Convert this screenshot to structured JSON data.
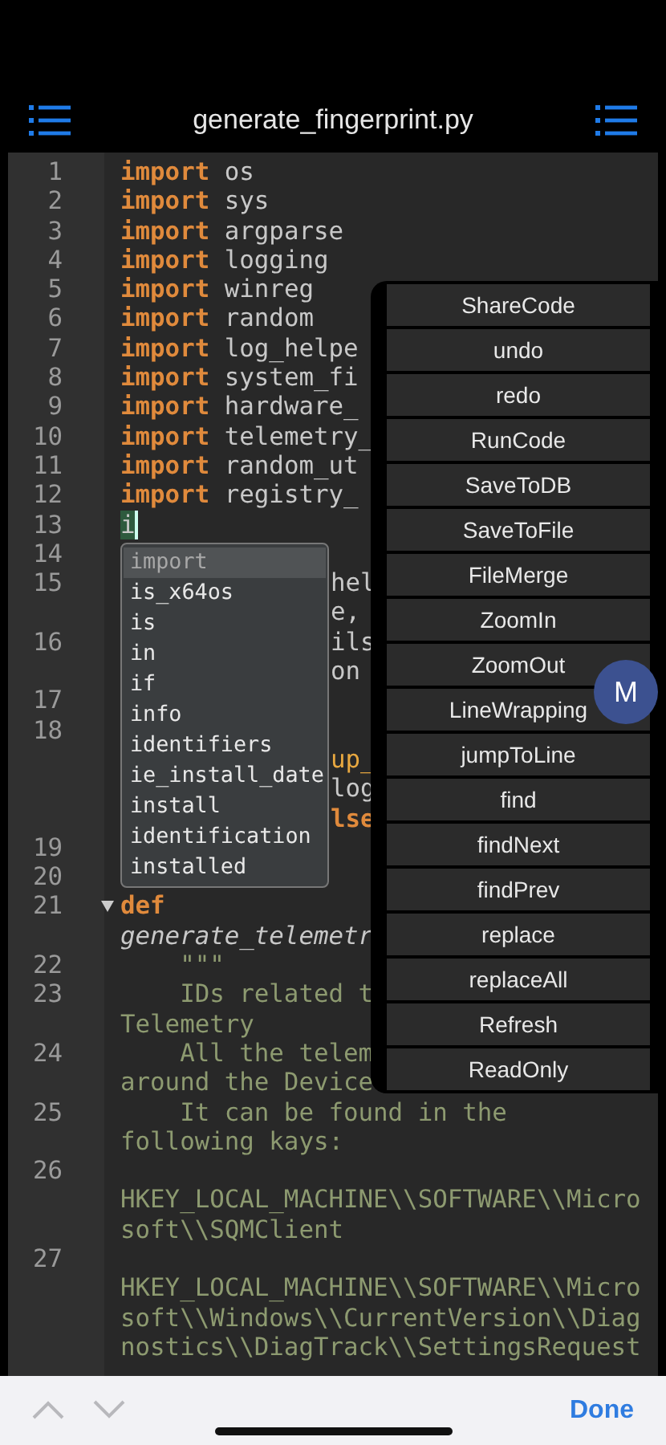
{
  "header": {
    "title": "generate_fingerprint.py"
  },
  "code_lines": [
    {
      "number": "1",
      "rows": [
        {
          "kind": "full",
          "segments": [
            {
              "kind": "kw",
              "text": "import"
            },
            {
              "kind": "plain",
              "text": " os"
            }
          ]
        }
      ]
    },
    {
      "number": "2",
      "rows": [
        {
          "kind": "full",
          "segments": [
            {
              "kind": "kw",
              "text": "import"
            },
            {
              "kind": "plain",
              "text": " sys"
            }
          ]
        }
      ]
    },
    {
      "number": "3",
      "rows": [
        {
          "kind": "full",
          "segments": [
            {
              "kind": "kw",
              "text": "import"
            },
            {
              "kind": "plain",
              "text": " argparse"
            }
          ]
        }
      ]
    },
    {
      "number": "4",
      "rows": [
        {
          "kind": "full",
          "segments": [
            {
              "kind": "kw",
              "text": "import"
            },
            {
              "kind": "plain",
              "text": " logging"
            }
          ]
        }
      ]
    },
    {
      "number": "5",
      "rows": [
        {
          "kind": "full",
          "segments": [
            {
              "kind": "kw",
              "text": "import"
            },
            {
              "kind": "plain",
              "text": " winreg"
            }
          ]
        }
      ]
    },
    {
      "number": "6",
      "rows": [
        {
          "kind": "full",
          "segments": [
            {
              "kind": "kw",
              "text": "import"
            },
            {
              "kind": "plain",
              "text": " random"
            }
          ]
        }
      ]
    },
    {
      "number": "7",
      "rows": [
        {
          "kind": "full",
          "segments": [
            {
              "kind": "kw",
              "text": "import"
            },
            {
              "kind": "plain",
              "text": " log_helpe"
            }
          ]
        }
      ]
    },
    {
      "number": "8",
      "rows": [
        {
          "kind": "full",
          "segments": [
            {
              "kind": "kw",
              "text": "import"
            },
            {
              "kind": "plain",
              "text": " system_fi"
            }
          ]
        }
      ]
    },
    {
      "number": "9",
      "rows": [
        {
          "kind": "full",
          "segments": [
            {
              "kind": "kw",
              "text": "import"
            },
            {
              "kind": "plain",
              "text": " hardware_"
            }
          ]
        }
      ]
    },
    {
      "number": "10",
      "rows": [
        {
          "kind": "full",
          "segments": [
            {
              "kind": "kw",
              "text": "import"
            },
            {
              "kind": "plain",
              "text": " telemetry_"
            }
          ]
        }
      ]
    },
    {
      "number": "11",
      "rows": [
        {
          "kind": "full",
          "segments": [
            {
              "kind": "kw",
              "text": "import"
            },
            {
              "kind": "plain",
              "text": " random_ut"
            }
          ]
        }
      ]
    },
    {
      "number": "12",
      "rows": [
        {
          "kind": "full",
          "segments": [
            {
              "kind": "kw",
              "text": "import"
            },
            {
              "kind": "plain",
              "text": " registry_"
            }
          ]
        }
      ]
    },
    {
      "number": "13",
      "rows": [
        {
          "kind": "full",
          "segments": [
            {
              "kind": "cursor",
              "text": "i"
            }
          ]
        }
      ]
    },
    {
      "number": "14"
    },
    {
      "number": "15",
      "rows": [
        {
          "kind": "tail",
          "segments": [
            {
              "kind": "plain",
              "text": "hel"
            }
          ]
        },
        {
          "kind": "tail",
          "segments": [
            {
              "kind": "plain",
              "text": "e,"
            }
          ]
        }
      ]
    },
    {
      "number": "16",
      "rows": [
        {
          "kind": "tail",
          "segments": [
            {
              "kind": "plain",
              "text": "ils"
            }
          ]
        },
        {
          "kind": "tail",
          "segments": [
            {
              "kind": "plain",
              "text": "on"
            }
          ]
        }
      ]
    },
    {
      "number": "17"
    },
    {
      "number": "18",
      "rows": [
        {
          "kind": "blank"
        },
        {
          "kind": "tail",
          "segments": [
            {
              "kind": "name",
              "text": "up_"
            }
          ]
        },
        {
          "kind": "tail",
          "segments": [
            {
              "kind": "plain",
              "text": "log"
            }
          ]
        },
        {
          "kind": "tail",
          "segments": [
            {
              "kind": "kw",
              "text": "lse"
            }
          ]
        }
      ]
    },
    {
      "number": "19"
    },
    {
      "number": "20"
    },
    {
      "number": "21",
      "foldable": true,
      "rows": [
        {
          "kind": "full",
          "segments": [
            {
              "kind": "kw",
              "text": "def"
            }
          ]
        },
        {
          "kind": "full",
          "segments": [
            {
              "kind": "defname",
              "text": "generate_telemetr"
            }
          ]
        }
      ]
    },
    {
      "number": "22",
      "rows": [
        {
          "kind": "full",
          "segments": [
            {
              "kind": "doc",
              "text": "    \"\"\""
            }
          ]
        }
      ]
    },
    {
      "number": "23",
      "rows": [
        {
          "kind": "full",
          "segments": [
            {
              "kind": "doc",
              "text": "    IDs related t"
            }
          ]
        },
        {
          "kind": "full",
          "segments": [
            {
              "kind": "doc",
              "text": "Telemetry"
            }
          ]
        }
      ]
    },
    {
      "number": "24",
      "rows": [
        {
          "kind": "full",
          "segments": [
            {
              "kind": "doc",
              "text": "    All the telem"
            }
          ]
        },
        {
          "kind": "full",
          "segments": [
            {
              "kind": "doc",
              "text": "around the Device"
            }
          ]
        }
      ]
    },
    {
      "number": "25",
      "rows": [
        {
          "kind": "full",
          "segments": [
            {
              "kind": "doc",
              "text": "    It can be found in the"
            }
          ]
        },
        {
          "kind": "full",
          "segments": [
            {
              "kind": "doc",
              "text": "following kays:"
            }
          ]
        }
      ]
    },
    {
      "number": "26",
      "rows": [
        {
          "kind": "blank"
        },
        {
          "kind": "full",
          "segments": [
            {
              "kind": "doc",
              "text": "HKEY_LOCAL_MACHINE\\\\SOFTWARE\\\\Micro"
            }
          ]
        },
        {
          "kind": "full",
          "segments": [
            {
              "kind": "doc",
              "text": "soft\\\\SQMClient"
            }
          ]
        }
      ]
    },
    {
      "number": "27",
      "rows": [
        {
          "kind": "blank"
        },
        {
          "kind": "full",
          "segments": [
            {
              "kind": "doc",
              "text": "HKEY_LOCAL_MACHINE\\\\SOFTWARE\\\\Micro"
            }
          ]
        },
        {
          "kind": "full",
          "segments": [
            {
              "kind": "doc",
              "text": "soft\\\\Windows\\\\CurrentVersion\\\\Diag"
            }
          ]
        },
        {
          "kind": "full",
          "segments": [
            {
              "kind": "doc",
              "text": "nostics\\\\DiagTrack\\\\SettingsRequest"
            }
          ]
        }
      ]
    }
  ],
  "autocomplete": [
    {
      "label": "import",
      "selected": true
    },
    {
      "label": "is_x64os",
      "selected": false
    },
    {
      "label": "is",
      "selected": false
    },
    {
      "label": "in",
      "selected": false
    },
    {
      "label": "if",
      "selected": false
    },
    {
      "label": "info",
      "selected": false
    },
    {
      "label": "identifiers",
      "selected": false
    },
    {
      "label": "ie_install_date",
      "selected": false
    },
    {
      "label": "install",
      "selected": false
    },
    {
      "label": "identification",
      "selected": false
    },
    {
      "label": "installed",
      "selected": false
    }
  ],
  "menu": [
    "ShareCode",
    "undo",
    "redo",
    "RunCode",
    "SaveToDB",
    "SaveToFile",
    "FileMerge",
    "ZoomIn",
    "ZoomOut",
    "LineWrapping",
    "jumpToLine",
    "find",
    "findNext",
    "findPrev",
    "replace",
    "replaceAll",
    "Refresh",
    "ReadOnly"
  ],
  "floating_button": "M",
  "bottom_bar": {
    "done": "Done"
  }
}
